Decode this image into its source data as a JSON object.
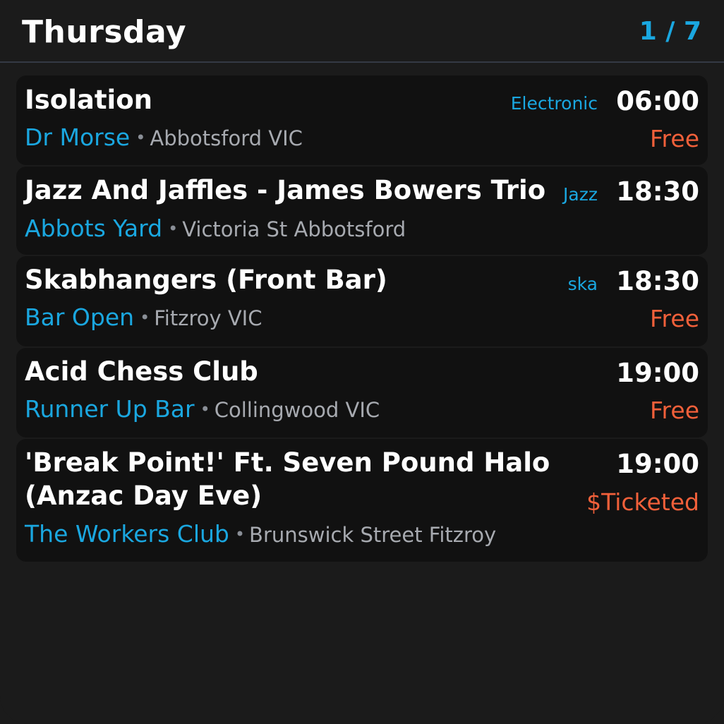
{
  "header": {
    "day": "Thursday",
    "page_counter": "1 / 7"
  },
  "events": [
    {
      "title": "Isolation",
      "genre": "Electronic",
      "time": "06:00",
      "venue": "Dr Morse",
      "location": "Abbotsford VIC",
      "price": "Free"
    },
    {
      "title": "Jazz And Jaffles - James Bowers Trio",
      "genre": "Jazz",
      "time": "18:30",
      "venue": "Abbots Yard",
      "location": "Victoria St Abbotsford",
      "price": ""
    },
    {
      "title": "Skabhangers (Front Bar)",
      "genre": "ska",
      "time": "18:30",
      "venue": "Bar Open",
      "location": "Fitzroy VIC",
      "price": "Free"
    },
    {
      "title": "Acid Chess Club",
      "genre": "",
      "time": "19:00",
      "venue": "Runner Up Bar",
      "location": "Collingwood VIC",
      "price": "Free"
    },
    {
      "title": "'Break Point!' Ft. Seven Pound Halo (Anzac Day Eve)",
      "genre": "",
      "time": "19:00",
      "venue": "The Workers Club",
      "location": "Brunswick Street Fitzroy",
      "price": "$Ticketed"
    }
  ],
  "separator": "•"
}
